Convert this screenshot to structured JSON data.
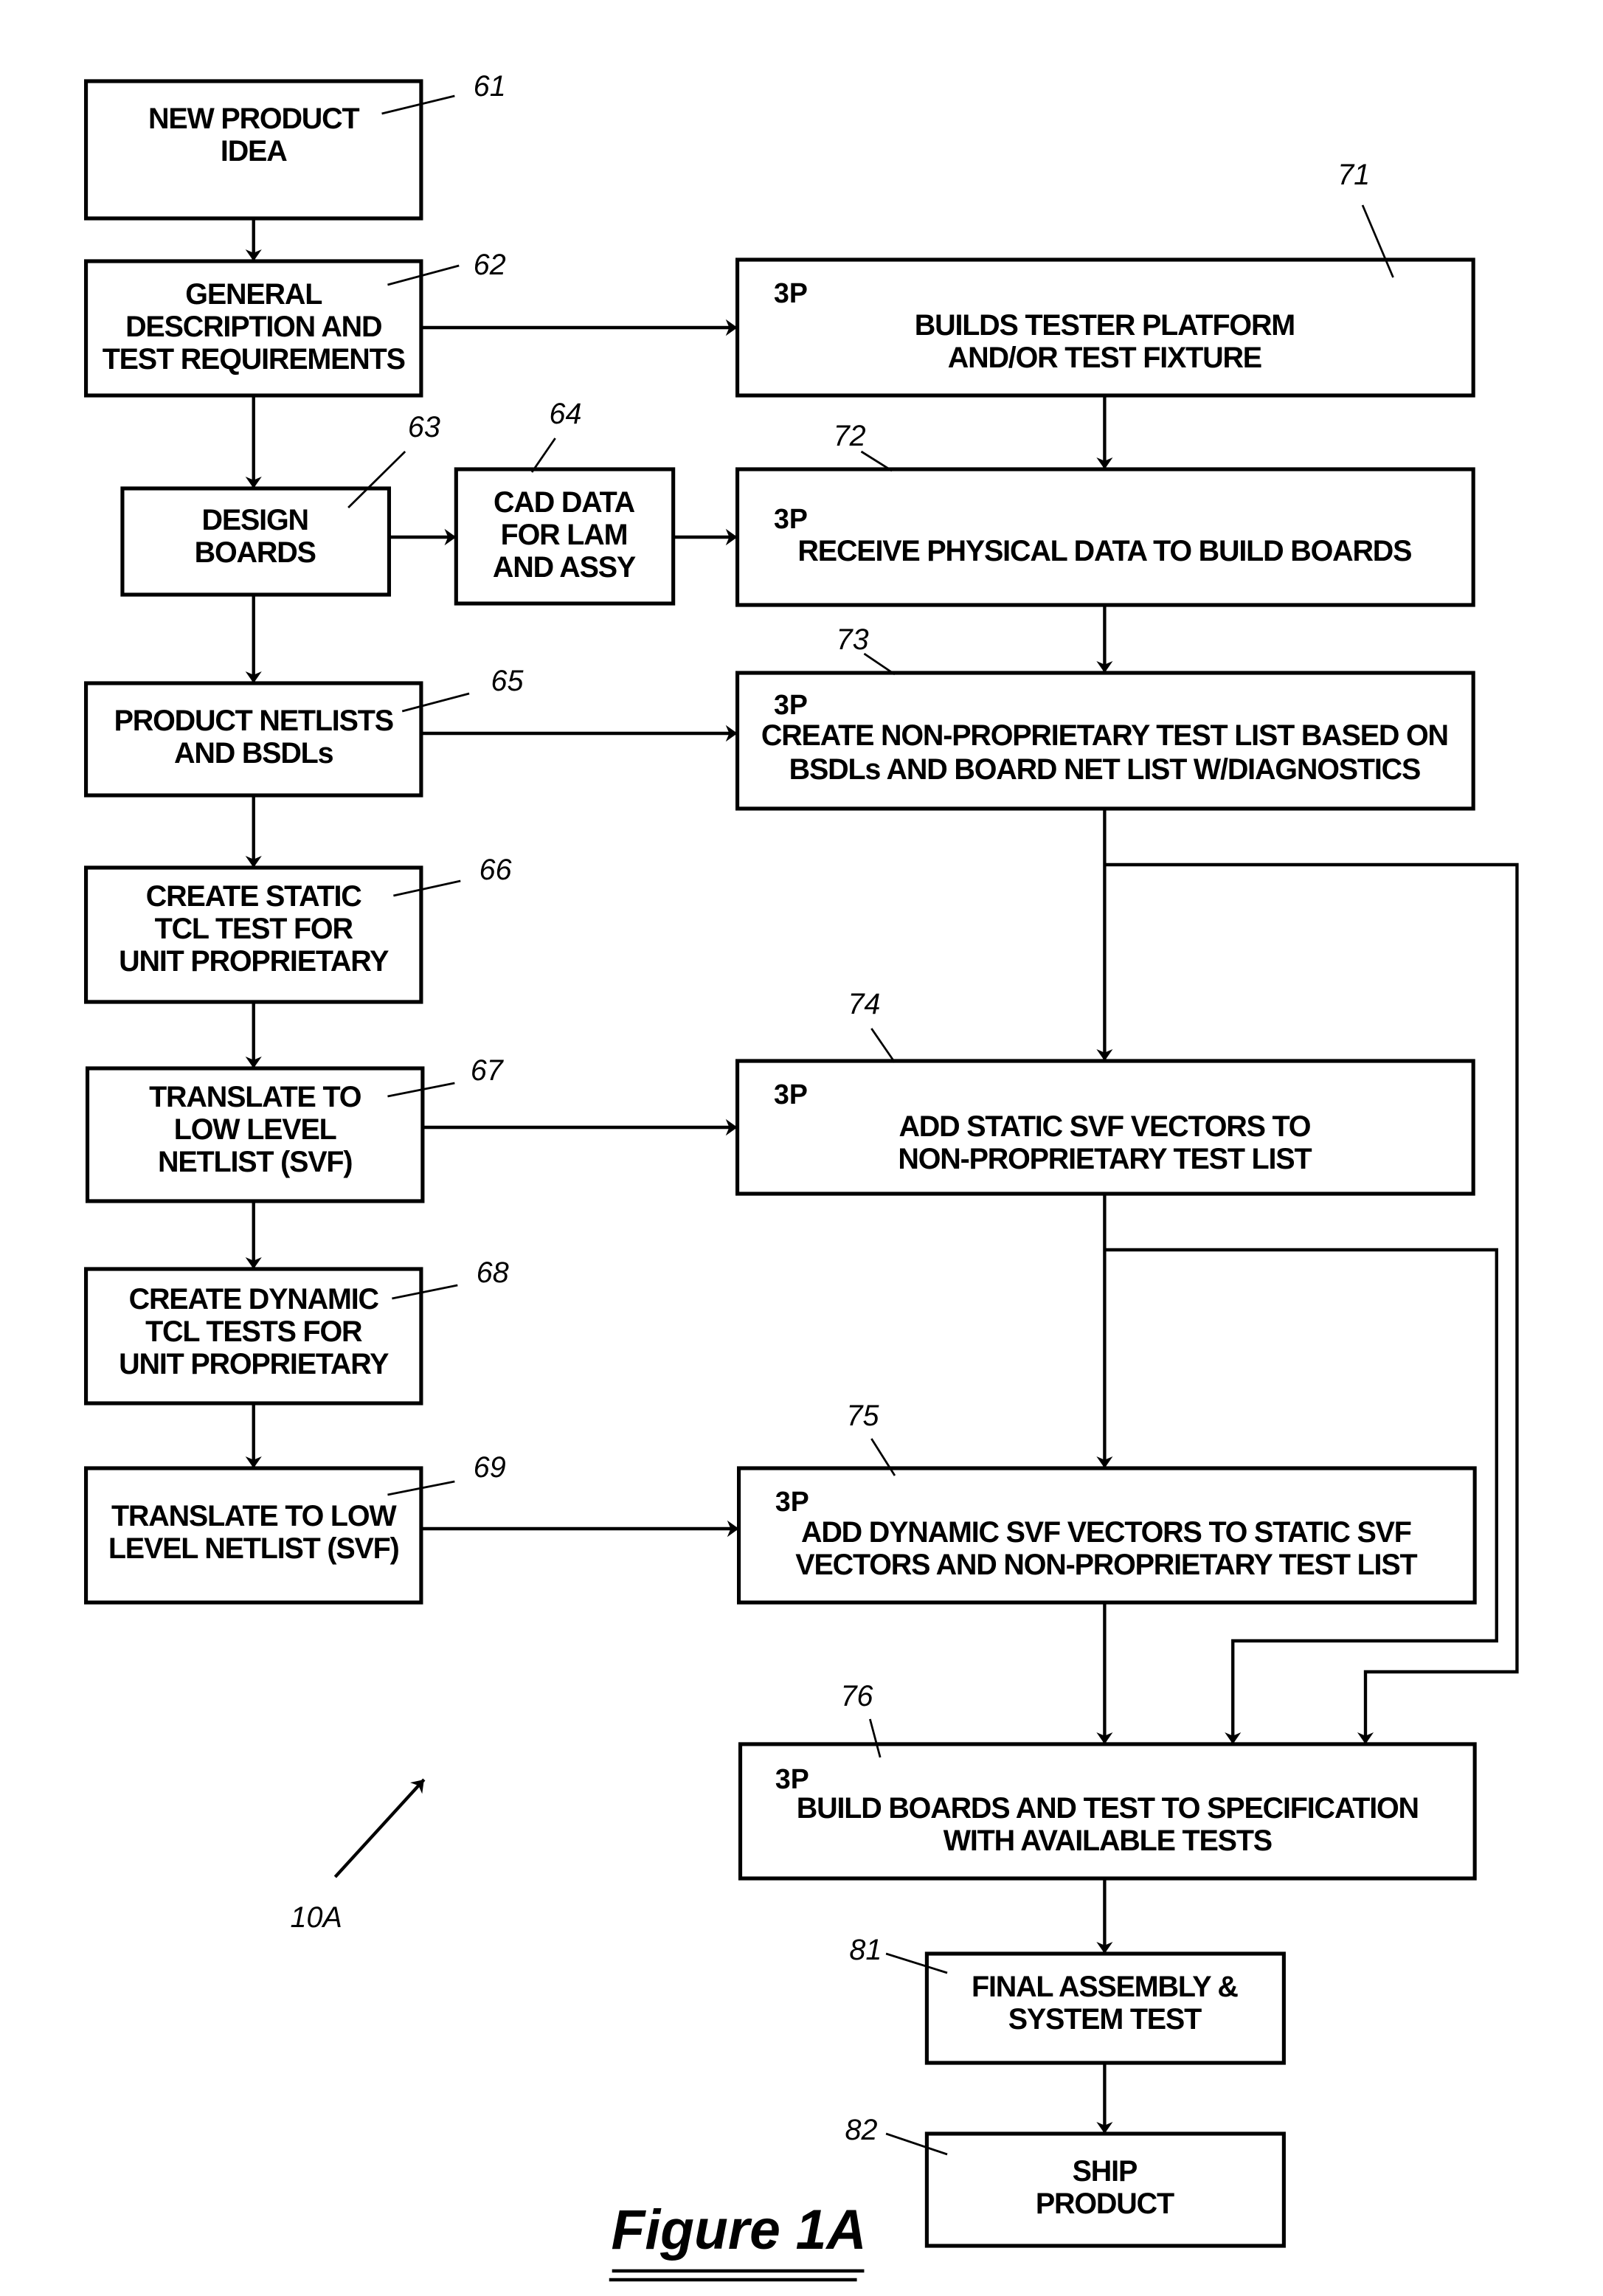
{
  "figure": {
    "caption": "Figure 1A",
    "reference": "10A"
  },
  "colors": {
    "ink": "#000000",
    "paper": "#ffffff"
  },
  "left_column": [
    {
      "ref": "61",
      "lines": [
        "NEW PRODUCT",
        "IDEA"
      ]
    },
    {
      "ref": "62",
      "lines": [
        "GENERAL",
        "DESCRIPTION AND",
        "TEST REQUIREMENTS"
      ]
    },
    {
      "ref": "63",
      "lines": [
        "DESIGN",
        "BOARDS"
      ]
    },
    {
      "ref": "64",
      "lines": [
        "CAD DATA",
        "FOR LAM",
        "AND ASSY"
      ]
    },
    {
      "ref": "65",
      "lines": [
        "PRODUCT NETLISTS",
        "AND BSDLs"
      ]
    },
    {
      "ref": "66",
      "lines": [
        "CREATE STATIC",
        "TCL TEST FOR",
        "UNIT PROPRIETARY"
      ]
    },
    {
      "ref": "67",
      "lines": [
        "TRANSLATE TO",
        "LOW LEVEL",
        "NETLIST (SVF)"
      ]
    },
    {
      "ref": "68",
      "lines": [
        "CREATE DYNAMIC",
        "TCL TESTS FOR",
        "UNIT PROPRIETARY"
      ]
    },
    {
      "ref": "69",
      "lines": [
        "TRANSLATE TO LOW",
        "LEVEL NETLIST (SVF)"
      ]
    }
  ],
  "right_column": [
    {
      "ref": "71",
      "tag": "3P",
      "lines": [
        "BUILDS TESTER PLATFORM",
        "AND/OR TEST FIXTURE"
      ]
    },
    {
      "ref": "72",
      "tag": "3P",
      "lines": [
        "RECEIVE PHYSICAL DATA TO BUILD BOARDS"
      ]
    },
    {
      "ref": "73",
      "tag": "3P",
      "lines": [
        "CREATE NON-PROPRIETARY TEST LIST BASED ON",
        "BSDLs AND BOARD NET LIST W/DIAGNOSTICS"
      ]
    },
    {
      "ref": "74",
      "tag": "3P",
      "lines": [
        "ADD STATIC SVF VECTORS TO",
        "NON-PROPRIETARY TEST LIST"
      ]
    },
    {
      "ref": "75",
      "tag": "3P",
      "lines": [
        "ADD DYNAMIC SVF VECTORS TO STATIC SVF",
        "VECTORS AND NON-PROPRIETARY TEST LIST"
      ]
    },
    {
      "ref": "76",
      "tag": "3P",
      "lines": [
        "BUILD BOARDS AND TEST TO SPECIFICATION",
        "WITH AVAILABLE TESTS"
      ]
    },
    {
      "ref": "81",
      "lines": [
        "FINAL ASSEMBLY &",
        "SYSTEM TEST"
      ]
    },
    {
      "ref": "82",
      "lines": [
        "SHIP",
        "PRODUCT"
      ]
    }
  ]
}
